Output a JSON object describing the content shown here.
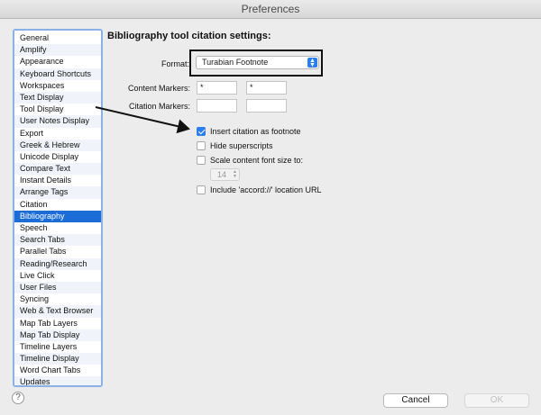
{
  "window": {
    "title": "Preferences"
  },
  "sidebar": {
    "selected_index": 15,
    "items": [
      "General",
      "Amplify",
      "Appearance",
      "Keyboard Shortcuts",
      "Workspaces",
      "Text Display",
      "Tool Display",
      "User Notes Display",
      "Export",
      "Greek & Hebrew",
      "Unicode Display",
      "Compare Text",
      "Instant Details",
      "Arrange Tags",
      "Citation",
      "Bibliography",
      "Speech",
      "Search Tabs",
      "Parallel Tabs",
      "Reading/Research",
      "Live Click",
      "User Files",
      "Syncing",
      "Web & Text Browser",
      "Map Tab Layers",
      "Map Tab Display",
      "Timeline Layers",
      "Timeline Display",
      "Word Chart Tabs",
      "Updates"
    ]
  },
  "main": {
    "heading": "Bibliography tool citation settings:",
    "format_label": "Format:",
    "format_value": "Turabian Footnote",
    "content_markers_label": "Content Markers:",
    "content_marker_open": "*",
    "content_marker_close": "*",
    "citation_markers_label": "Citation Markers:",
    "citation_marker_open": "",
    "citation_marker_close": "",
    "options": {
      "insert_footnote": {
        "label": "Insert citation as footnote",
        "checked": true
      },
      "hide_superscripts": {
        "label": "Hide superscripts",
        "checked": false
      },
      "scale_font": {
        "label": "Scale content font size to:",
        "checked": false
      },
      "include_url": {
        "label": "Include 'accord://' location URL",
        "checked": false
      }
    },
    "font_size_value": "14"
  },
  "footer": {
    "help_label": "?",
    "cancel_label": "Cancel",
    "ok_label": "OK"
  },
  "colors": {
    "accent": "#1c6cd8",
    "sidebar_border": "#8ab1e6"
  }
}
